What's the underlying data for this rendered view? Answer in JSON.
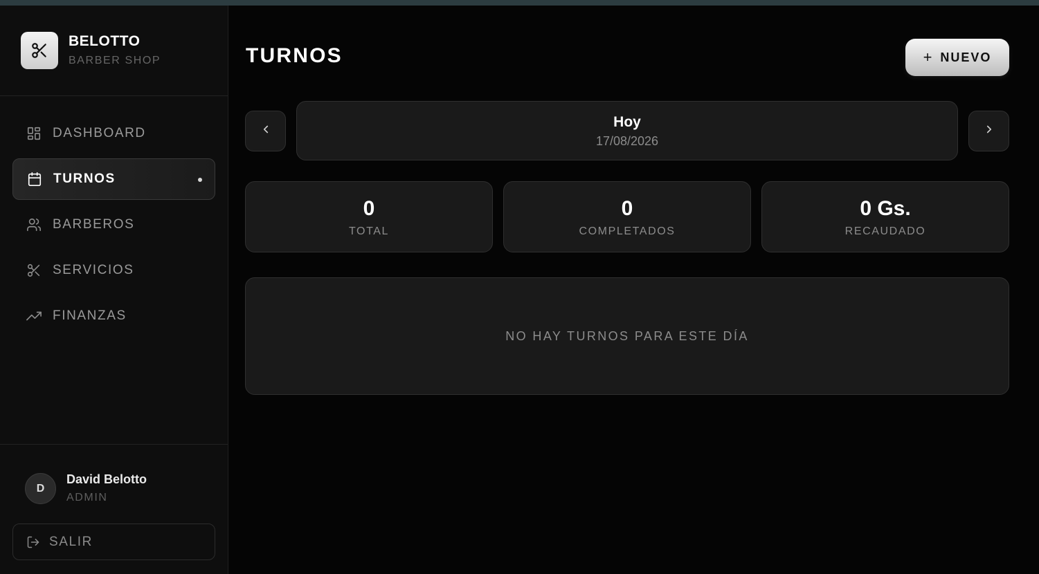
{
  "brand": {
    "name": "BELOTTO",
    "subtitle": "BARBER SHOP",
    "logo_icon": "scissors-icon"
  },
  "nav": {
    "items": [
      {
        "label": "DASHBOARD",
        "icon": "grid-icon",
        "active": false
      },
      {
        "label": "TURNOS",
        "icon": "calendar-icon",
        "active": true
      },
      {
        "label": "BARBEROS",
        "icon": "users-icon",
        "active": false
      },
      {
        "label": "SERVICIOS",
        "icon": "scissors-icon",
        "active": false
      },
      {
        "label": "FINANZAS",
        "icon": "trending-up-icon",
        "active": false
      }
    ]
  },
  "user": {
    "initial": "D",
    "name": "David Belotto",
    "role": "ADMIN"
  },
  "logout": {
    "label": "SALIR",
    "icon": "logout-icon"
  },
  "header": {
    "title": "TURNOS",
    "new_button": "NUEVO",
    "new_icon": "plus-icon"
  },
  "date_nav": {
    "label": "Hoy",
    "date": "17/08/2026",
    "prev_icon": "chevron-left-icon",
    "next_icon": "chevron-right-icon"
  },
  "stats": [
    {
      "value": "0",
      "label": "TOTAL"
    },
    {
      "value": "0",
      "label": "COMPLETADOS"
    },
    {
      "value": "0 Gs.",
      "label": "RECAUDADO"
    }
  ],
  "empty_state": {
    "message": "NO HAY TURNOS PARA ESTE DÍA"
  },
  "colors": {
    "background": "#050505",
    "sidebar": "#0e0e0e",
    "card": "#1a1a1a",
    "border": "#2f2f2f",
    "accent_top": "#2c3c40"
  }
}
